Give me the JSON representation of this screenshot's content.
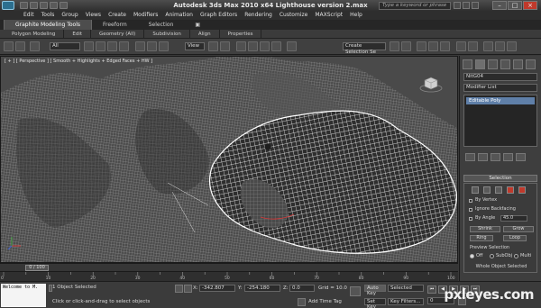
{
  "window": {
    "title": "Autodesk 3ds Max  2010 x64    Lighthouse version 2.max",
    "search_placeholder": "Type a keyword or phrase"
  },
  "menu": [
    "Edit",
    "Tools",
    "Group",
    "Views",
    "Create",
    "Modifiers",
    "Animation",
    "Graph Editors",
    "Rendering",
    "Customize",
    "MAXScript",
    "Help"
  ],
  "ribbon": {
    "tabs": [
      "Graphite Modeling Tools",
      "Freeform",
      "Selection"
    ],
    "panels": [
      "Polygon Modeling",
      "Edit",
      "Geometry (All)",
      "Subdivision",
      "Align",
      "Properties"
    ]
  },
  "toolbar": {
    "filter_value": "All",
    "ref_coord_value": "View",
    "named_selection_value": "Create Selection Se"
  },
  "viewport": {
    "label": "[ + ] [ Perspective ] [ Smooth + Highlights + Edged Faces + HW ]"
  },
  "command_panel": {
    "object_name": "NitG04",
    "modifier_list": "Modifier List",
    "stack_item": "Editable Poly",
    "rollout_title": "Selection",
    "by_vertex": "By Vertex",
    "ignore_backfacing": "Ignore Backfacing",
    "by_angle": "By Angle",
    "angle_value": "45.0",
    "shrink": "Shrink",
    "grow": "Grow",
    "ring": "Ring",
    "loop": "Loop",
    "preview_selection": "Preview Selection",
    "off": "Off",
    "subobj": "SubObj",
    "multi": "Multi",
    "status": "Whole Object Selected"
  },
  "timeline": {
    "frame": "0 / 100",
    "ticks": [
      "0",
      "10",
      "20",
      "30",
      "40",
      "50",
      "60",
      "70",
      "80",
      "90",
      "100"
    ]
  },
  "status": {
    "maxscript": "Welcome to M.",
    "selected": "1 Object Selected",
    "prompt": "Click or click-and-drag to select objects",
    "x_label": "X:",
    "x_value": "-342.807",
    "y_label": "Y:",
    "y_value": "-254.180",
    "z_label": "Z:",
    "z_value": "0.0",
    "grid": "Grid = 10.0",
    "add_time_tag": "Add Time Tag",
    "auto_key": "Auto Key",
    "set_key": "Set Key",
    "key_mode_value": "Selected",
    "key_filters": "Key Filters...",
    "current_frame": "0"
  },
  "watermark": "pxleyes.com",
  "colors": {
    "accent_blue": "#5f7fa8",
    "mesh_white": "#ffffff",
    "close_red": "#c0392b"
  }
}
